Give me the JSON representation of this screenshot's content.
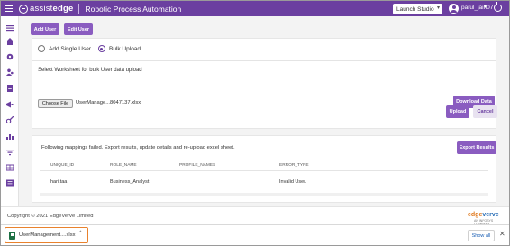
{
  "header": {
    "logo_left": "assist",
    "logo_right": "edge",
    "app_title": "Robotic Process Automation",
    "launch_label": "Launch Studio",
    "username": "parul_jain07"
  },
  "sidebar": {
    "items": [
      "menu-icon",
      "home-icon",
      "settings-icon",
      "users-icon",
      "document-icon",
      "megaphone-icon",
      "key-icon",
      "network-icon",
      "filter-icon",
      "table-icon",
      "list-icon"
    ]
  },
  "toolbar": {
    "add_user": "Add User",
    "edit_user": "Edit User"
  },
  "upload": {
    "option_single": "Add Single User",
    "option_bulk": "Bulk Upload",
    "select_label": "Select Worksheet for bulk User data upload",
    "choose_file": "Choose File",
    "file_name": "UserManage...8047137.xlsx",
    "download_data": "Download Data",
    "upload_btn": "Upload",
    "cancel_btn": "Cancel"
  },
  "results": {
    "message": "Following mappings failed. Export results, update details and re-upload excel sheet.",
    "export_btn": "Export Results",
    "columns": [
      "UNIQUE_ID",
      "ROLE_NAME",
      "PROFILE_NAMES",
      "ERROR_TYPE"
    ],
    "rows": [
      [
        "hari.taa",
        "Business_Analyst",
        "",
        "Invalid User."
      ]
    ]
  },
  "footer": {
    "copyright": "Copyright © 2021 EdgeVerve Limited",
    "brand_a": "edge",
    "brand_b": "verve",
    "brand_sub": "AN INFOSYS COMPANY"
  },
  "downloads": {
    "file": "UserManagement....xlsx",
    "show_all": "Show all"
  }
}
